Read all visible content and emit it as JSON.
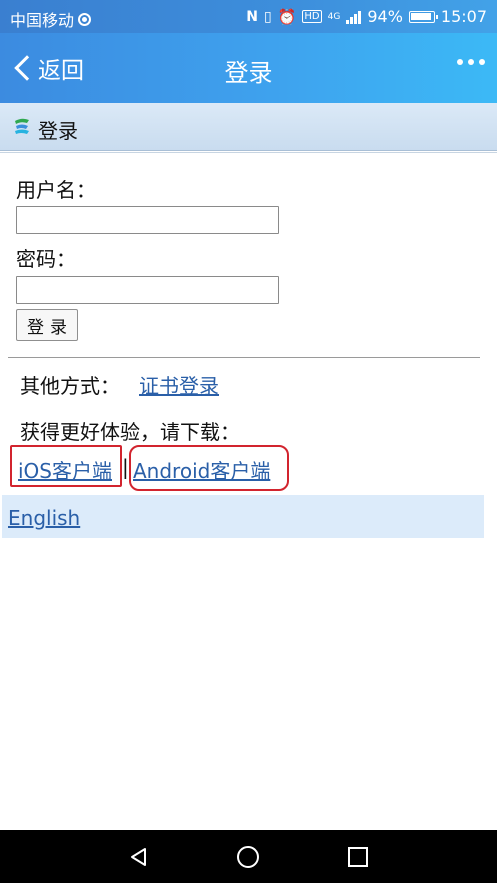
{
  "status_bar": {
    "carrier": "中国移动",
    "network": "4G",
    "battery": "94%",
    "time": "15:07"
  },
  "title_bar": {
    "back_label": "返回",
    "title": "登录"
  },
  "section": {
    "title": "登录"
  },
  "form": {
    "username_label": "用户名：",
    "username_value": "",
    "password_label": "密码：",
    "password_value": "",
    "submit_label": "登录"
  },
  "other": {
    "label": "其他方式：",
    "cert_link": "证书登录",
    "download_label": "获得更好体验，请下载：",
    "ios_link": "iOS客户端",
    "separator": "|",
    "android_link": "Android客户端"
  },
  "footer": {
    "english_link": "English"
  },
  "colors": {
    "accent": "#3ea2ee",
    "link": "#2a5fa8",
    "highlight_box": "#d2242e"
  }
}
